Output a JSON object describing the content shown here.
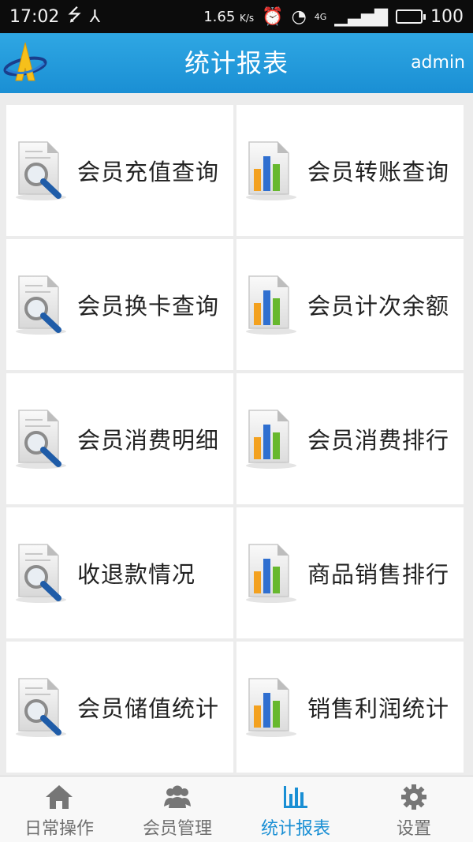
{
  "status_bar": {
    "time": "17:02",
    "speed": "1.65",
    "speed_unit": "K/s",
    "network": "4G",
    "battery": "100",
    "battery_level": 1.0
  },
  "header": {
    "title": "统计报表",
    "user": "admin",
    "bg_color": "#1f97da"
  },
  "tiles": [
    {
      "label": "会员充值查询",
      "icon": "search-report-icon"
    },
    {
      "label": "会员转账查询",
      "icon": "bar-report-icon"
    },
    {
      "label": "会员换卡查询",
      "icon": "search-report-icon"
    },
    {
      "label": "会员计次余额",
      "icon": "bar-report-icon"
    },
    {
      "label": "会员消费明细",
      "icon": "search-report-icon"
    },
    {
      "label": "会员消费排行",
      "icon": "bar-report-icon"
    },
    {
      "label": "收退款情况",
      "icon": "search-report-icon"
    },
    {
      "label": "商品销售排行",
      "icon": "bar-report-icon"
    },
    {
      "label": "会员储值统计",
      "icon": "search-report-icon"
    },
    {
      "label": "销售利润统计",
      "icon": "bar-report-icon"
    }
  ],
  "bottom_nav": {
    "items": [
      {
        "label": "日常操作",
        "icon": "home-icon",
        "active": false
      },
      {
        "label": "会员管理",
        "icon": "members-icon",
        "active": false
      },
      {
        "label": "统计报表",
        "icon": "bar-chart-icon",
        "active": true
      },
      {
        "label": "设置",
        "icon": "gear-icon",
        "active": false
      }
    ],
    "active_color": "#1a8fd4"
  }
}
